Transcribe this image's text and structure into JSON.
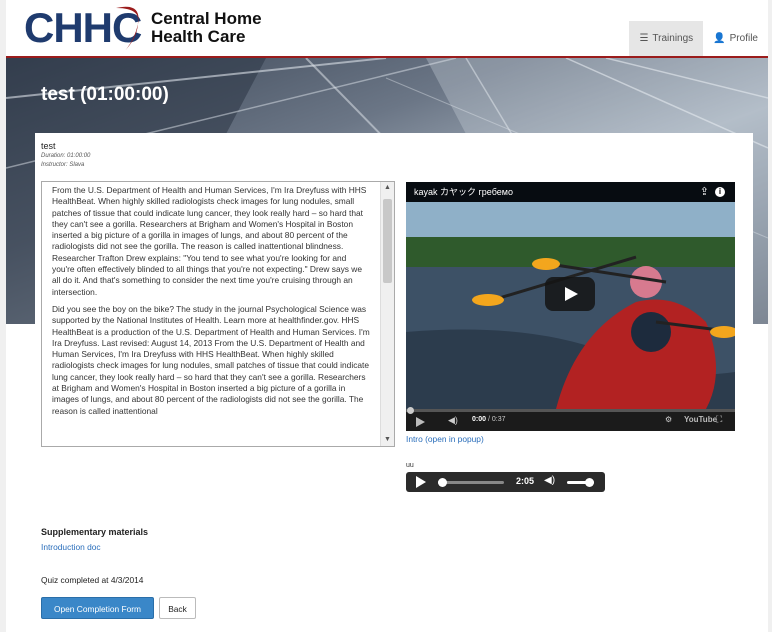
{
  "header": {
    "logo_text": "CHHC",
    "brand_line1": "Central Home",
    "brand_line2": "Health Care",
    "nav": [
      {
        "label": "Trainings",
        "icon": "list-icon",
        "active": true
      },
      {
        "label": "Profile",
        "icon": "user-icon",
        "active": false
      }
    ]
  },
  "hero": {
    "title": "test (01:00:00)"
  },
  "training": {
    "name": "test",
    "duration": "Duration: 01:00:00",
    "instructor": "Instructor: Slava"
  },
  "content": {
    "paragraphs": [
      "From the U.S. Department of Health and Human Services, I'm Ira Dreyfuss with HHS HealthBeat. When highly skilled radiologists check images for lung nodules, small patches of tissue that could indicate lung cancer, they look really hard – so hard that they can't see a gorilla. Researchers at Brigham and Women's Hospital in Boston inserted a big picture of a gorilla in images of lungs, and about 80 percent of the radiologists did not see the gorilla. The reason is called inattentional blindness. Researcher Trafton Drew explains: \"You tend to see what you're looking for and you're often effectively blinded to all things that you're not expecting.\" Drew says we all do it. And that's something to consider the next time you're cruising through an intersection.",
      "Did you see the boy on the bike? The study in the journal Psychological Science was supported by the National Institutes of Health. Learn more at healthfinder.gov. HHS HealthBeat is a production of the U.S. Department of Health and Human Services. I'm Ira Dreyfuss. Last revised: August 14, 2013 From the U.S. Department of Health and Human Services, I'm Ira Dreyfuss with HHS HealthBeat. When highly skilled radiologists check images for lung nodules, small patches of tissue that could indicate lung cancer, they look really hard – so hard that they can't see a gorilla. Researchers at Brigham and Women's Hospital in Boston inserted a big picture of a gorilla in images of lungs, and about 80 percent of the radiologists did not see the gorilla. The reason is called inattentional"
    ]
  },
  "video": {
    "title": "kayak カヤック гребемо",
    "current_time": "0:00",
    "duration": "/ 0:37",
    "brand": "YouTube",
    "link": "Intro (open in popup)"
  },
  "audio": {
    "label": "uu",
    "time": "2:05",
    "progress_fraction": 0.05,
    "volume_fraction": 1.0
  },
  "supplementary": {
    "heading": "Supplementary materials",
    "link": "Introduction doc"
  },
  "quiz": {
    "status": "Quiz completed at 4/3/2014"
  },
  "actions": {
    "primary": "Open Completion Form",
    "back": "Back"
  },
  "colors": {
    "brand_navy": "#1f3b6e",
    "brand_red": "#9b1c1c",
    "link": "#2a6ebb",
    "primary_button": "#3a87c8"
  }
}
